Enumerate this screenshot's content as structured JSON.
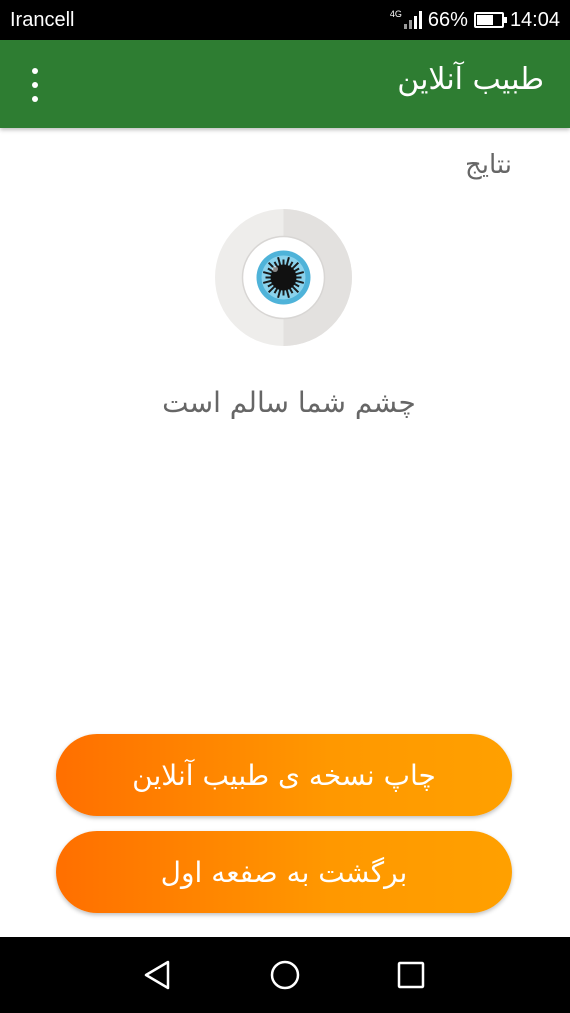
{
  "status_bar": {
    "carrier": "Irancell",
    "network_type": "4G",
    "battery_percent": "66%",
    "battery_level": 0.66,
    "time": "14:04"
  },
  "app_bar": {
    "title": "طبیب آنلاین",
    "menu_icon": "more-vert-icon",
    "color": "#2e7d32"
  },
  "content": {
    "section_title": "نتایج",
    "result_icon": "eye-icon",
    "result_text": "چشم شما سالم است"
  },
  "buttons": {
    "print_label": "چاپ نسخه ی طبیب آنلاین",
    "home_label": "برگشت به صفعه اول",
    "color_start": "#ff6f00",
    "color_end": "#ffa000"
  },
  "nav_bar": {
    "back_icon": "back-triangle-icon",
    "home_icon": "home-circle-icon",
    "recents_icon": "recents-square-icon"
  }
}
